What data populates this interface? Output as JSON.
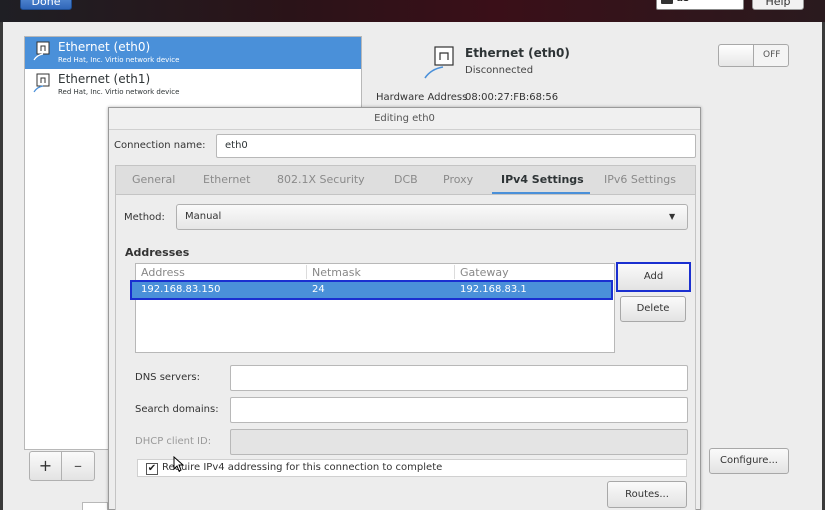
{
  "header": {
    "done_label": "Done",
    "keyboard_layout": "us",
    "help_label": "Help"
  },
  "devices": {
    "items": [
      {
        "name": "Ethernet (eth0)",
        "vendor": "Red Hat, Inc. Virtio network device",
        "selected": true
      },
      {
        "name": "Ethernet (eth1)",
        "vendor": "Red Hat, Inc. Virtio network device",
        "selected": false
      }
    ],
    "add_label": "+",
    "remove_label": "–"
  },
  "detail": {
    "name": "Ethernet (eth0)",
    "status": "Disconnected",
    "hw_label": "Hardware Address",
    "hw_value": "08:00:27:FB:68:56",
    "toggle_label": "OFF",
    "configure_label": "Configure..."
  },
  "dialog": {
    "title": "Editing eth0",
    "connection_name_label": "Connection name:",
    "connection_name_value": "eth0",
    "tabs": [
      "General",
      "Ethernet",
      "802.1X Security",
      "DCB",
      "Proxy",
      "IPv4 Settings",
      "IPv6 Settings"
    ],
    "active_tab": "IPv4 Settings",
    "method_label": "Method:",
    "method_value": "Manual",
    "addresses_heading": "Addresses",
    "columns": [
      "Address",
      "Netmask",
      "Gateway"
    ],
    "rows": [
      {
        "address": "192.168.83.150",
        "netmask": "24",
        "gateway": "192.168.83.1"
      }
    ],
    "add_label": "Add",
    "delete_label": "Delete",
    "dns_label": "DNS servers:",
    "search_label": "Search domains:",
    "dhcp_label": "DHCP client ID:",
    "require_label": "Require IPv4 addressing for this connection to complete",
    "require_checked": true,
    "routes_label": "Routes..."
  },
  "colors": {
    "accent": "#4a90d9",
    "highlight_border": "#1a2fd0"
  }
}
